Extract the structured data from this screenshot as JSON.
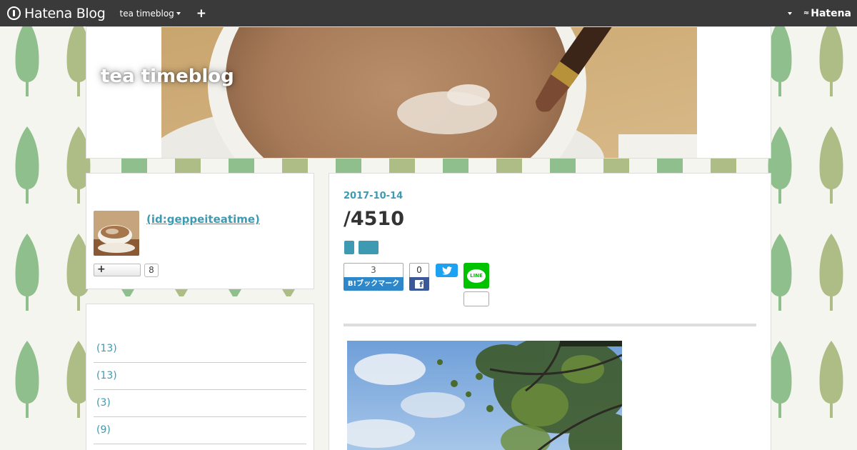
{
  "topbar": {
    "logo_text": "Hatena Blog",
    "blog_menu_label": "tea timeblog",
    "add_label": "+",
    "brand_label": "Hatena"
  },
  "header": {
    "blog_title": "tea timeblog"
  },
  "profile": {
    "user_id": " (id:geppeiteatime)",
    "follow_label": "+",
    "follower_count": "8"
  },
  "categories": [
    {
      "label": "(13)"
    },
    {
      "label": "(13)"
    },
    {
      "label": "(3)"
    },
    {
      "label": "(9)"
    }
  ],
  "entry": {
    "date": "2017-10-14",
    "title": "/4510"
  },
  "share": {
    "hatena_bookmark_count": "3",
    "hatena_bookmark_label": "B!ブックマーク",
    "facebook_count": "0",
    "line_label": "LINE"
  },
  "colors": {
    "accent": "#3d9ab1",
    "topbar": "#3a3a3a",
    "hatena_blue": "#2d87c8",
    "facebook": "#3b5998",
    "twitter": "#1da1f2",
    "line": "#00c300"
  }
}
